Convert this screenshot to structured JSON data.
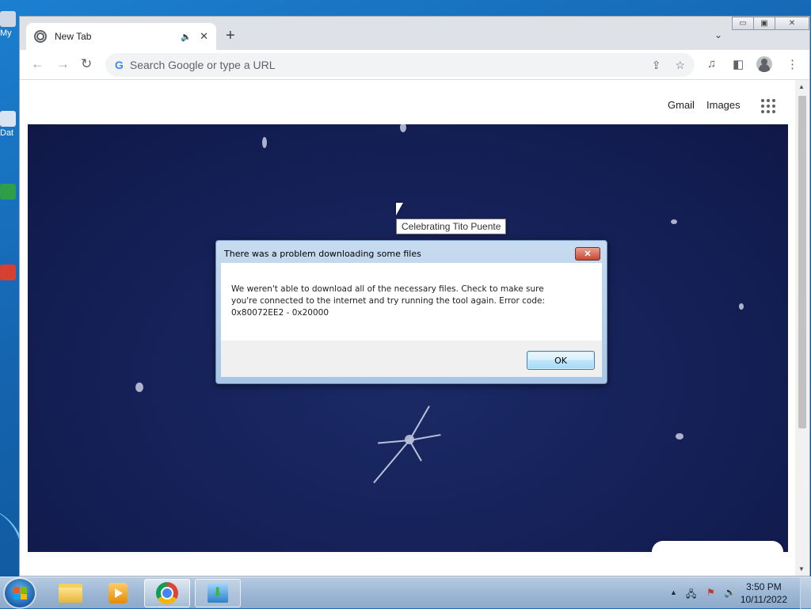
{
  "desktop": {
    "icons": [
      {
        "label": "My"
      },
      {
        "label": "Dat"
      }
    ]
  },
  "browser": {
    "tab": {
      "title": "New Tab",
      "audio_icon": "speaker-icon",
      "close": "✕"
    },
    "newtab": "+",
    "tabsearch": "⌄",
    "window_controls": {
      "minimize": "▭",
      "maximize": "▣",
      "close": "✕"
    },
    "nav": {
      "back": "←",
      "forward": "→",
      "reload": "↻"
    },
    "omnibox": {
      "placeholder": "Search Google or type a URL",
      "google_g": "G"
    },
    "omni_icons": {
      "share": "⇪",
      "bookmark": "☆"
    },
    "toolbar_icons": {
      "media": "♫",
      "sidepanel": "◧",
      "menu": "⋮"
    }
  },
  "page": {
    "links": {
      "gmail": "Gmail",
      "images": "Images"
    },
    "doodle_tooltip": "Celebrating Tito Puente"
  },
  "dialog": {
    "title": "There was a problem downloading some files",
    "close": "✕",
    "message": "We weren't able to download all of the necessary files. Check to make sure you're connected to the internet and try running the tool again. Error code: 0x80072EE2 - 0x20000",
    "ok_label": "OK"
  },
  "taskbar": {
    "tray": {
      "show_hidden": "▲",
      "network": "🖧",
      "flag": "⚑",
      "volume": "🔊"
    },
    "clock": {
      "time": "3:50 PM",
      "date": "10/11/2022"
    }
  },
  "colors": {
    "accent": "#1a73e8",
    "doodle_bg": "#141f55",
    "dialog_frame": "#a9c6e6"
  }
}
